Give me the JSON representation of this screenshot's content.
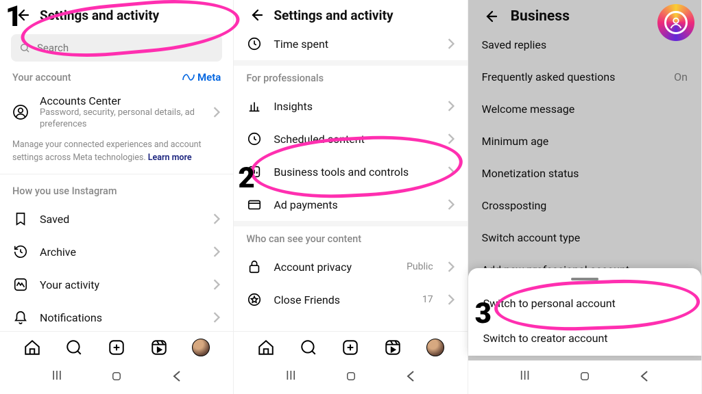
{
  "annotations": {
    "step1": "1",
    "step2": "2",
    "step3": "3"
  },
  "phone1": {
    "title": "Settings and activity",
    "search_placeholder": "Search",
    "meta_section": "Your account",
    "meta_brand": "Meta",
    "ac_title": "Accounts Center",
    "ac_sub": "Password, security, personal details, ad preferences",
    "note": "Manage your connected experiences and account settings across Meta technologies.",
    "learn_more": "Learn more",
    "howuse": "How you use Instagram",
    "items": [
      "Saved",
      "Archive",
      "Your activity",
      "Notifications"
    ]
  },
  "phone2": {
    "title": "Settings and activity",
    "time": "Time spent",
    "prof_h": "For professionals",
    "prof": [
      "Insights",
      "Scheduled content",
      "Business tools and controls",
      "Ad payments"
    ],
    "who_h": "Who can see your content",
    "privacy": "Account privacy",
    "privacy_value": "Public",
    "close": "Close Friends",
    "close_value": "17"
  },
  "phone3": {
    "title": "Business",
    "items": [
      "Saved replies",
      "Frequently asked questions",
      "Welcome message",
      "Minimum age",
      "Monetization status",
      "Crossposting",
      "Switch account type",
      "Add new professional account"
    ],
    "faq_value": "On",
    "sheet": [
      "Switch to personal account",
      "Switch to creator account"
    ]
  }
}
